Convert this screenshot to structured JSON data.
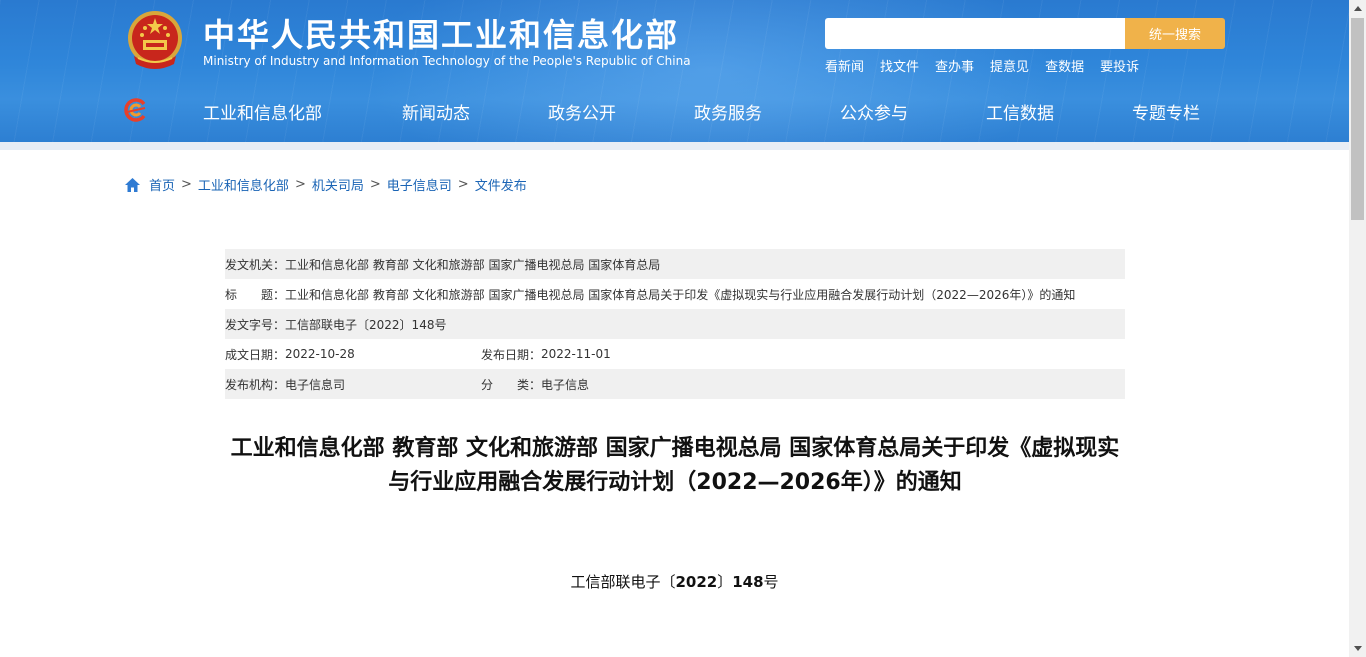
{
  "header": {
    "title": "中华人民共和国工业和信息化部",
    "subtitle": "Ministry of Industry and Information Technology of the People's Republic of China",
    "search": {
      "placeholder": "",
      "button_label": "统一搜索"
    },
    "quick_links": [
      "看新闻",
      "找文件",
      "查办事",
      "提意见",
      "查数据",
      "要投诉"
    ],
    "nav": [
      "工业和信息化部",
      "新闻动态",
      "政务公开",
      "政务服务",
      "公众参与",
      "工信数据",
      "专题专栏"
    ],
    "icons": {
      "emblem": "national-emblem-icon",
      "nav_logo": "miit-logo-icon"
    },
    "colors": {
      "banner": "#2f86da",
      "search_button": "#f0b24a"
    }
  },
  "breadcrumb": {
    "icon": "home-icon",
    "items": [
      "首页",
      "工业和信息化部",
      "机关司局",
      "电子信息司",
      "文件发布"
    ],
    "separator": ">"
  },
  "info": {
    "issuer_label": "发文机关：",
    "issuer": "工业和信息化部 教育部 文化和旅游部 国家广播电视总局 国家体育总局",
    "title_label": "标　　题：",
    "title": "工业和信息化部 教育部 文化和旅游部 国家广播电视总局 国家体育总局关于印发《虚拟现实与行业应用融合发展行动计划（2022—2026年）》的通知",
    "docno_label": "发文字号：",
    "docno": "工信部联电子〔2022〕148号",
    "date_label": "成文日期：",
    "date": "2022-10-28",
    "pub_date_label": "发布日期：",
    "pub_date": "2022-11-01",
    "org_label": "发布机构：",
    "org": "电子信息司",
    "category_label": "分　　类：",
    "category": "电子信息"
  },
  "article": {
    "title": "工业和信息化部 教育部 文化和旅游部 国家广播电视总局 国家体育总局关于印发《虚拟现实与行业应用融合发展行动计划（2022—2026年）》的通知",
    "doc_number_prefix": "工信部联电子〔",
    "doc_number_year": "2022",
    "doc_number_mid": "〕",
    "doc_number_num": "148",
    "doc_number_suffix": "号"
  }
}
